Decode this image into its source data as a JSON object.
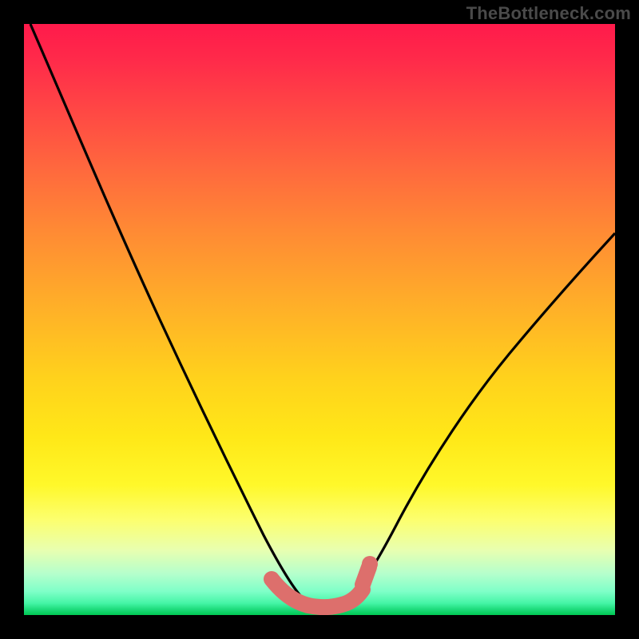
{
  "watermark": "TheBottleneck.com",
  "chart_data": {
    "type": "line",
    "title": "",
    "xlabel": "",
    "ylabel": "",
    "xlim": [
      0,
      100
    ],
    "ylim": [
      0,
      100
    ],
    "grid": false,
    "legend": false,
    "series": [
      {
        "name": "curve",
        "color": "#000000",
        "x": [
          0,
          5,
          10,
          15,
          20,
          25,
          30,
          35,
          40,
          42,
          44,
          47,
          50,
          53,
          55,
          57,
          60,
          65,
          70,
          75,
          80,
          85,
          90,
          95,
          100
        ],
        "y": [
          100,
          90,
          80,
          70,
          60,
          50,
          40,
          30,
          20,
          14,
          9,
          4,
          2,
          2,
          3,
          6,
          12,
          22,
          32,
          41,
          49,
          56,
          62,
          67,
          71
        ]
      },
      {
        "name": "highlight-points",
        "color": "#de716e",
        "x": [
          41,
          43,
          45,
          47,
          49,
          51,
          53,
          55,
          56,
          57
        ],
        "y": [
          6,
          4,
          3,
          2.6,
          2.4,
          2.4,
          2.6,
          3.2,
          6,
          9
        ]
      }
    ],
    "background_gradient": {
      "orientation": "vertical",
      "stops": [
        {
          "pos": 0.0,
          "color": "#ff1a4b"
        },
        {
          "pos": 0.5,
          "color": "#ffc020"
        },
        {
          "pos": 0.8,
          "color": "#fff830"
        },
        {
          "pos": 1.0,
          "color": "#00c853"
        }
      ]
    }
  }
}
